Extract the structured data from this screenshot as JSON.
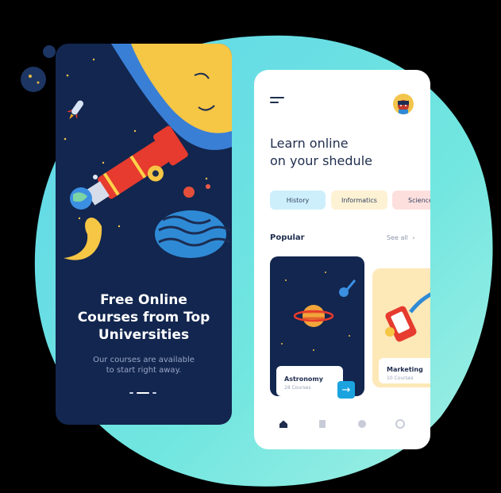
{
  "colors": {
    "background": "#000000",
    "blob": "#6de3e6",
    "navy": "#12264f",
    "accent_blue": "#1aa3df",
    "chip_history": "#cdeffb",
    "chip_informatics": "#fdf2d4",
    "chip_science": "#fde0de",
    "marketing_card": "#fde8b8"
  },
  "onboarding": {
    "title_line1": "Free Online",
    "title_line2": "Courses from Top",
    "title_line3": "Universities",
    "subtitle_line1": "Our courses are available",
    "subtitle_line2": "to start right away."
  },
  "home": {
    "headline_line1": "Learn online",
    "headline_line2": "on your shedule",
    "chips": [
      {
        "label": "History"
      },
      {
        "label": "Informatics"
      },
      {
        "label": "Science"
      }
    ],
    "popular_title": "Popular",
    "see_all": "See all",
    "see_all_icon": "chevron-right-icon",
    "courses": [
      {
        "title": "Astronomy",
        "count": "28 Courses"
      },
      {
        "title": "Marketing",
        "count": "10 Courses"
      }
    ],
    "arrow_icon": "arrow-right-icon",
    "nav_icons": [
      "home-icon",
      "document-icon",
      "chat-icon",
      "settings-icon"
    ]
  }
}
